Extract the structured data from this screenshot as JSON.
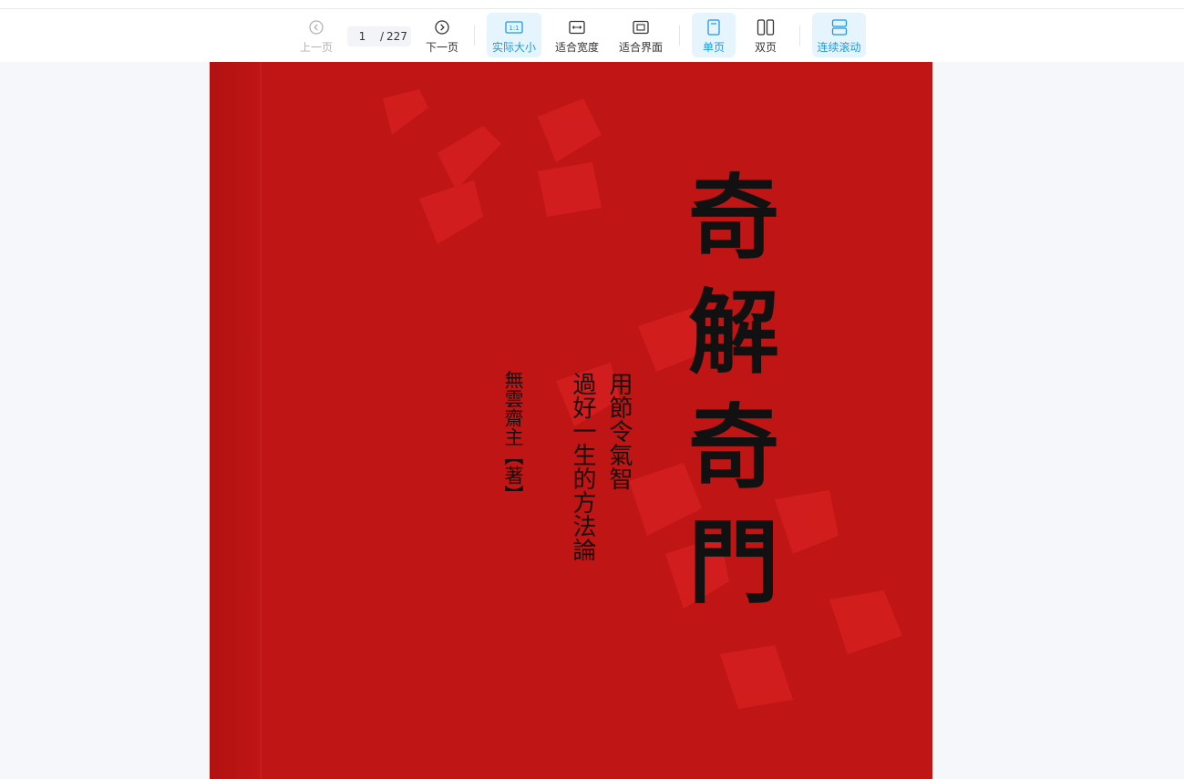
{
  "toolbar": {
    "prev_label": "上一页",
    "next_label": "下一页",
    "current_page": "1",
    "page_separator": "/",
    "total_pages": "227",
    "actual_size_label": "实际大小",
    "fit_width_label": "适合宽度",
    "fit_page_label": "适合界面",
    "single_page_label": "单页",
    "double_page_label": "双页",
    "continuous_scroll_label": "连续滚动",
    "actual_size_icon_text": "1:1",
    "active_color": "#1e9ae0",
    "active_bg": "#e6f4fd"
  },
  "document": {
    "cover_color": "#c01515",
    "title_chars": [
      "奇",
      "解",
      "奇",
      "門"
    ],
    "subtitle_line1": "用節令氣智",
    "subtitle_line2": "過好一生的方法論",
    "author": "無雲齋主【著】"
  }
}
